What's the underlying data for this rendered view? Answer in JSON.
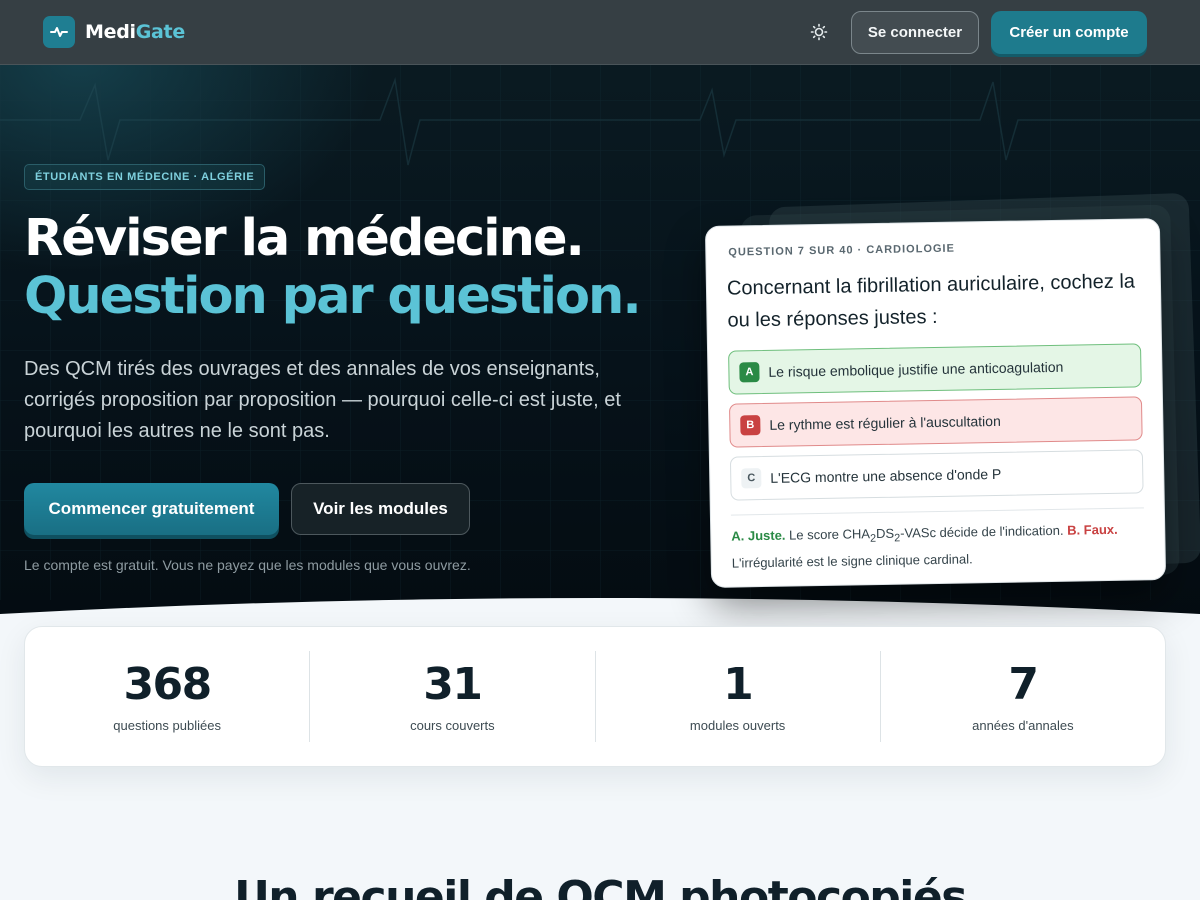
{
  "nav": {
    "brand_part1": "Medi",
    "brand_part2": "Gate",
    "theme_icon": "sun-icon",
    "login_label": "Se connecter",
    "signup_label": "Créer un compte"
  },
  "hero": {
    "badge": "ÉTUDIANTS EN MÉDECINE · ALGÉRIE",
    "title_line1": "Réviser la médecine.",
    "title_line2": "Question par question.",
    "lead": "Des QCM tirés des ouvrages et des annales de vos enseignants, corrigés proposition par proposition — pourquoi celle-ci est juste, et pourquoi les autres ne le sont pas.",
    "cta_primary": "Commencer gratuitement",
    "cta_secondary": "Voir les modules",
    "note": "Le compte est gratuit. Vous ne payez que les modules que vous ouvrez."
  },
  "question_card": {
    "meta": "QUESTION 7 SUR 40 · CARDIOLOGIE",
    "title": "Concernant la fibrillation auriculaire, cochez la ou les réponses justes :",
    "options": [
      {
        "letter": "A",
        "text": "Le risque embolique justifie une anticoagulation",
        "state": "correct"
      },
      {
        "letter": "B",
        "text": "Le rythme est régulier à l'auscultation",
        "state": "wrong"
      },
      {
        "letter": "C",
        "text": "L'ECG montre une absence d'onde P",
        "state": "neutral"
      }
    ],
    "explanation": {
      "a_label": "A. Juste.",
      "a_text_pre": " Le score CHA",
      "sub1": "2",
      "a_text_mid": "DS",
      "sub2": "2",
      "a_text_post": "-VASc décide de l'indication. ",
      "b_label": "B. Faux.",
      "b_text": " L'irrégularité est le signe clinique cardinal."
    }
  },
  "stats": [
    {
      "value": "368",
      "label": "questions publiées"
    },
    {
      "value": "31",
      "label": "cours couverts"
    },
    {
      "value": "1",
      "label": "modules ouverts"
    },
    {
      "value": "7",
      "label": "années d'annales"
    }
  ],
  "section": {
    "title": "Un recueil de QCM photocopiés"
  },
  "colors": {
    "accent": "#5bc3d6",
    "primary": "#1e7b8d",
    "correct": "#2a8a45",
    "wrong": "#c94242"
  }
}
